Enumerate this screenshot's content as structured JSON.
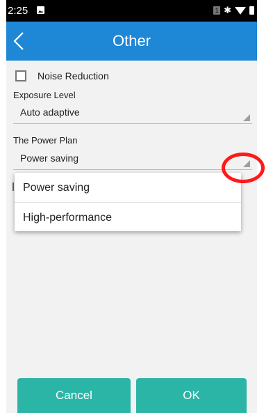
{
  "status_bar": {
    "time": "2:25",
    "sim_label": "1",
    "icons": [
      "image-icon",
      "sim-icon",
      "bluetooth-icon",
      "wifi-icon",
      "battery-icon"
    ]
  },
  "app_bar": {
    "title": "Other",
    "back_icon": "chevron-left-icon",
    "color": "#1e88d6"
  },
  "settings": {
    "noise_reduction": {
      "label": "Noise Reduction",
      "checked": false
    },
    "exposure": {
      "label": "Exposure Level",
      "value": "Auto adaptive"
    },
    "power_plan": {
      "label": "The Power Plan",
      "value": "Power saving"
    }
  },
  "dropdown": {
    "options": [
      "Power saving",
      "High-performance"
    ]
  },
  "buttons": {
    "cancel": "Cancel",
    "ok": "OK",
    "color": "#2bb5a6"
  },
  "annotation": {
    "color": "#ff1a1a"
  }
}
